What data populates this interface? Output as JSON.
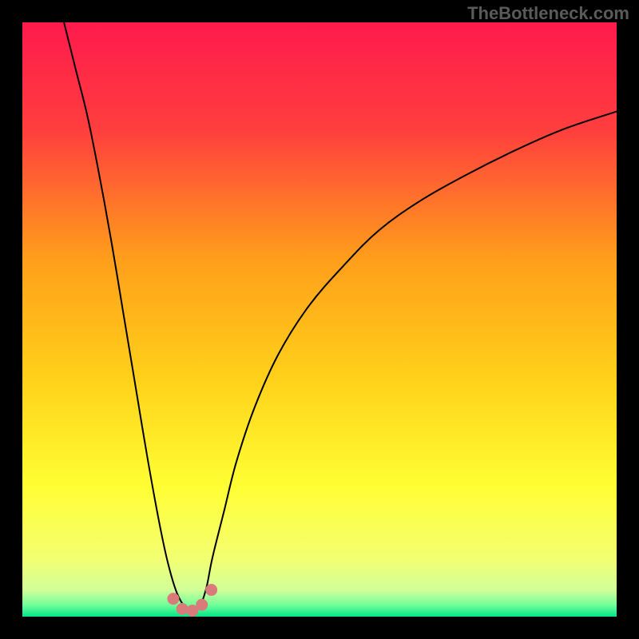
{
  "watermark": "TheBottleneck.com",
  "chart_data": {
    "type": "line",
    "title": "",
    "xlabel": "",
    "ylabel": "",
    "xlim": [
      0,
      100
    ],
    "ylim": [
      0,
      100
    ],
    "background_gradient": {
      "stops": [
        {
          "offset": 0.0,
          "color": "#ff1a4d"
        },
        {
          "offset": 0.18,
          "color": "#ff3e3e"
        },
        {
          "offset": 0.4,
          "color": "#ff9f1a"
        },
        {
          "offset": 0.6,
          "color": "#ffd11a"
        },
        {
          "offset": 0.78,
          "color": "#ffff33"
        },
        {
          "offset": 0.9,
          "color": "#f4ff70"
        },
        {
          "offset": 0.955,
          "color": "#d2ff99"
        },
        {
          "offset": 0.98,
          "color": "#75ff99"
        },
        {
          "offset": 1.0,
          "color": "#00e68a"
        }
      ]
    },
    "series": [
      {
        "name": "bottleneck-curve",
        "color": "#000000",
        "x": [
          7,
          9,
          11,
          13,
          15,
          17,
          19,
          21,
          23,
          24.5,
          26,
          27.5,
          29,
          30,
          31,
          32,
          34,
          36,
          39,
          43,
          48,
          54,
          60,
          67,
          75,
          83,
          91,
          100
        ],
        "y": [
          100,
          92,
          84,
          74,
          63,
          51,
          39,
          27,
          16,
          9,
          4,
          1.5,
          1,
          2,
          5,
          10,
          18,
          26,
          35,
          44,
          52,
          59,
          65,
          70,
          74.5,
          78.5,
          82,
          85
        ]
      }
    ],
    "marker_cluster": {
      "name": "optimal-zone-markers",
      "color": "#d97b7b",
      "points": [
        {
          "x": 25.4,
          "y": 3.0
        },
        {
          "x": 26.9,
          "y": 1.3
        },
        {
          "x": 28.6,
          "y": 1.0
        },
        {
          "x": 30.2,
          "y": 2.0
        },
        {
          "x": 31.8,
          "y": 4.5
        }
      ]
    }
  }
}
